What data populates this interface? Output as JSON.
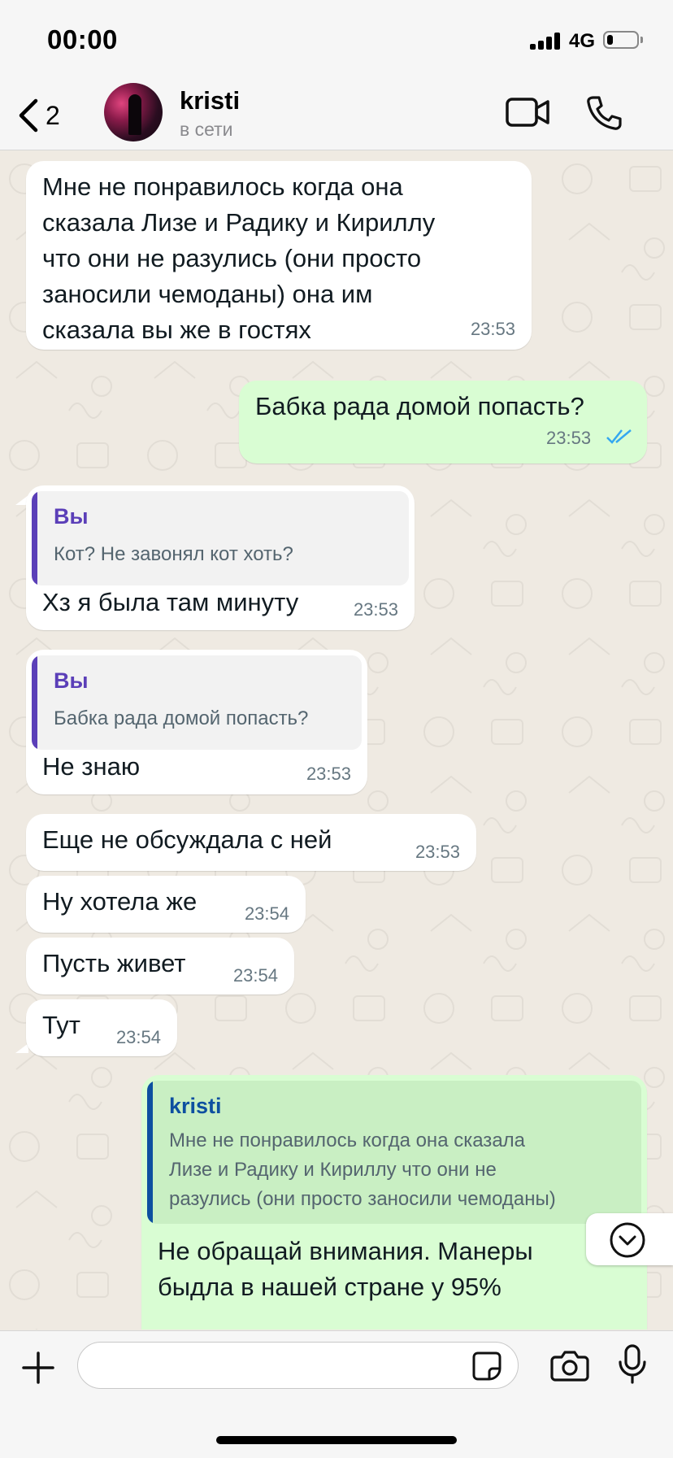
{
  "status_bar": {
    "time": "00:00",
    "network": "4G",
    "battery_level": 0.2
  },
  "header": {
    "back_count": "2",
    "contact_name": "kristi",
    "contact_status": "в сети"
  },
  "messages": [
    {
      "direction": "in",
      "text": "Мне не понравилось когда она\nсказала Лизе и Радику и Кириллу\nчто они не разулись (они просто\nзаносили чемоданы) она им\nсказала вы же в гостях",
      "time": "23:53"
    },
    {
      "direction": "out",
      "text": "Бабка рада домой попасть?",
      "time": "23:53",
      "read": true
    },
    {
      "direction": "in",
      "quote_author": "Вы",
      "quote_text": "Кот? Не завонял кот хоть?",
      "text": "Хз я была там минуту",
      "time": "23:53"
    },
    {
      "direction": "in",
      "quote_author": "Вы",
      "quote_text": "Бабка рада домой попасть?",
      "text": "Не знаю",
      "time": "23:53"
    },
    {
      "direction": "in",
      "text": "Еще не обсуждала с ней",
      "time": "23:53"
    },
    {
      "direction": "in",
      "text": "Ну хотела же",
      "time": "23:54"
    },
    {
      "direction": "in",
      "text": "Пусть живет",
      "time": "23:54"
    },
    {
      "direction": "in",
      "text": "Тут",
      "time": "23:54"
    },
    {
      "direction": "out",
      "quote_author": "kristi",
      "quote_text": "Мне не понравилось когда она сказала\nЛизе и Радику и Кириллу что они не\nразулись (они просто заносили чемоданы)",
      "text": "Не обращай внимания. Манеры\nбыдла в нашей стране у 95%"
    }
  ],
  "input": {
    "placeholder": ""
  },
  "colors": {
    "chat_bg": "#efeae2",
    "incoming_bubble": "#ffffff",
    "outgoing_bubble": "#d9fdd3",
    "quote_you": "#5b3fb8",
    "quote_contact": "#0d4fa0",
    "read_ticks": "#34a7f0",
    "icon": "#1a1a1a"
  },
  "icons": [
    "back-chevron-icon",
    "video-call-icon",
    "phone-icon",
    "double-check-icon",
    "chevron-down-icon",
    "plus-icon",
    "sticker-icon",
    "camera-icon",
    "microphone-icon"
  ]
}
